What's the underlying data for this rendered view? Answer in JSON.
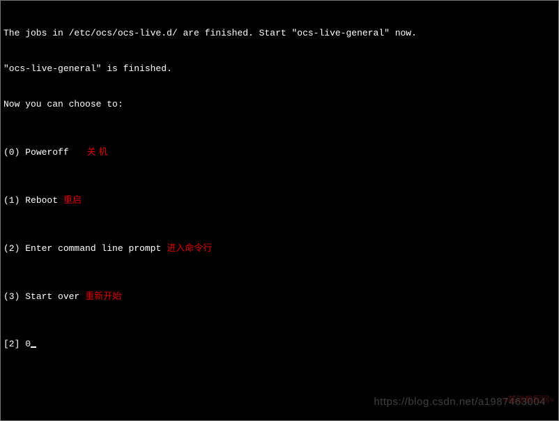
{
  "header": {
    "line1": "The jobs in /etc/ocs/ocs-live.d/ are finished. Start \"ocs-live-general\" now.",
    "line2": "\"ocs-live-general\" is finished.",
    "line3": "Now you can choose to:"
  },
  "options": [
    {
      "key": "(0)",
      "label": "Poweroff",
      "annotation": "关 机",
      "ann_class": "wide"
    },
    {
      "key": "(1)",
      "label": "Reboot",
      "annotation": "重启",
      "ann_class": ""
    },
    {
      "key": "(2)",
      "label": "Enter command line prompt",
      "annotation": "进入命令行",
      "ann_class": ""
    },
    {
      "key": "(3)",
      "label": "Start over",
      "annotation": "重新开始",
      "ann_class": ""
    }
  ],
  "prompt": {
    "bracket": "[2] ",
    "input_value": "0"
  },
  "watermark": {
    "url": "https://blog.csdn.net/a1987463004",
    "site": "«基础教程网»"
  }
}
